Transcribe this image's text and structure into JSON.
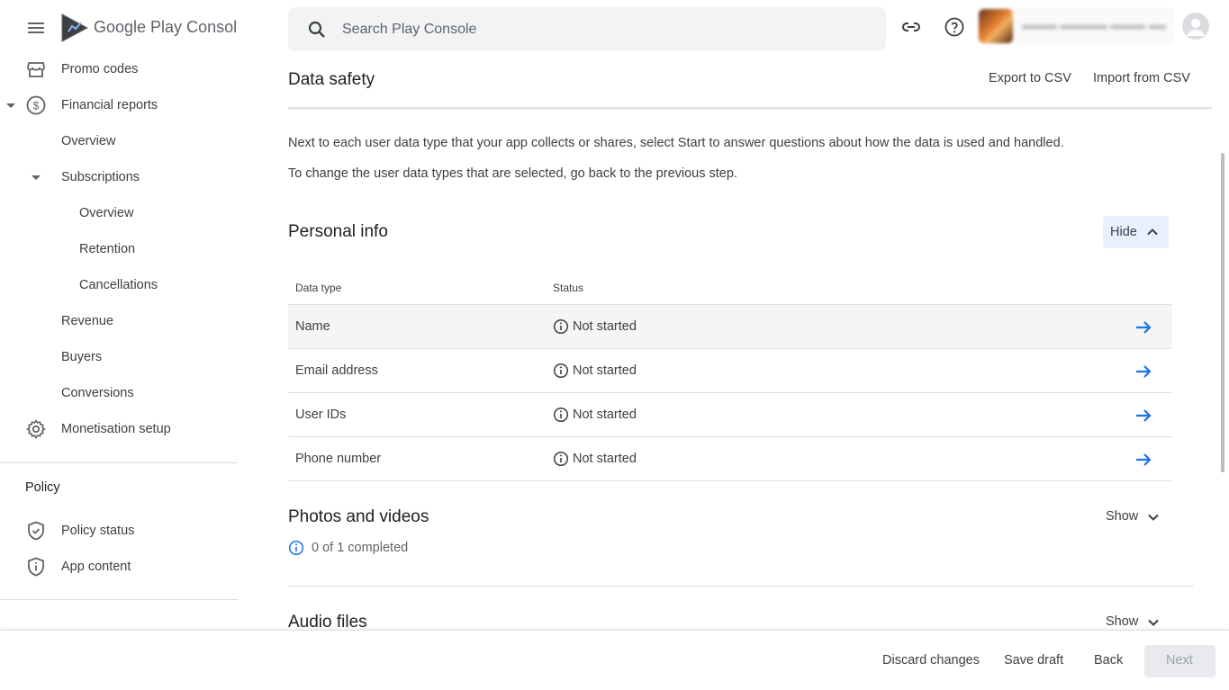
{
  "brand": {
    "name_google": "Google Play",
    "name_console": "Console"
  },
  "sidebar": {
    "items": [
      {
        "label": "Promo codes",
        "icon": "store-icon"
      },
      {
        "label": "Financial reports",
        "icon": "dollar-circle-icon"
      },
      {
        "label": "Overview"
      },
      {
        "label": "Subscriptions"
      },
      {
        "label": "Overview"
      },
      {
        "label": "Retention"
      },
      {
        "label": "Cancellations"
      },
      {
        "label": "Revenue"
      },
      {
        "label": "Buyers"
      },
      {
        "label": "Conversions"
      },
      {
        "label": "Monetisation setup",
        "icon": "gear-icon"
      }
    ],
    "policy_section": "Policy",
    "policy_items": [
      {
        "label": "Policy status",
        "icon": "shield-check-icon"
      },
      {
        "label": "App content",
        "icon": "shield-info-icon"
      }
    ]
  },
  "search": {
    "placeholder": "Search Play Console"
  },
  "page": {
    "title": "Data safety",
    "export_label": "Export to CSV",
    "import_label": "Import from CSV",
    "description_1": "Next to each user data type that your app collects or shares, select Start to answer questions about how the data is used and handled.",
    "description_2": "To change the user data types that are selected, go back to the previous step."
  },
  "personal_info": {
    "title": "Personal info",
    "toggle_label": "Hide",
    "columns": {
      "data_type": "Data type",
      "status": "Status"
    },
    "rows": [
      {
        "data_type": "Name",
        "status": "Not started"
      },
      {
        "data_type": "Email address",
        "status": "Not started"
      },
      {
        "data_type": "User IDs",
        "status": "Not started"
      },
      {
        "data_type": "Phone number",
        "status": "Not started"
      }
    ]
  },
  "photos_videos": {
    "title": "Photos and videos",
    "toggle_label": "Show",
    "progress": "0 of 1 completed"
  },
  "audio_files": {
    "title": "Audio files",
    "toggle_label": "Show"
  },
  "footer": {
    "discard": "Discard changes",
    "save": "Save draft",
    "back": "Back",
    "next": "Next"
  },
  "colors": {
    "accent": "#1a73e8",
    "hide_bg": "#e8f0fe",
    "text": "#3c4043"
  }
}
